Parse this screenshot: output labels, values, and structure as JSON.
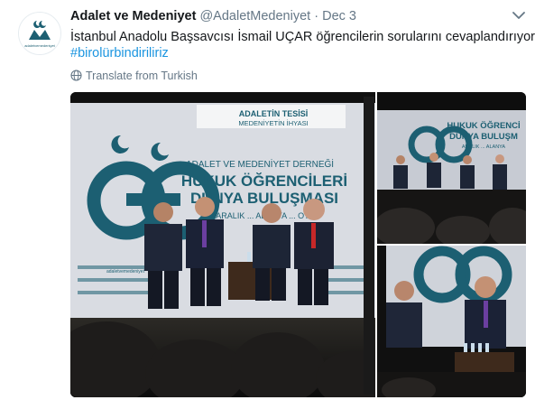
{
  "tweet": {
    "display_name": "Adalet ve Medeniyet",
    "handle": "@AdaletMedeniyet",
    "separator": "·",
    "date": "Dec 3",
    "text": "İstanbul Anadolu Başsavcısı İsmail UÇAR öğrencilerin sorularını cevaplandırıyor.",
    "hashtag": "#birolürbindiriliriz",
    "translate_label": "Translate from Turkish",
    "avatar_label": "adaletvemedeniyet"
  },
  "photo_main": {
    "header_line1": "ADALETİN TESİSİ",
    "header_line2": "MEDENİYETİN İHYASI",
    "title_line1": "ADALET VE MEDENİYET DERNEĞİ",
    "title_line2": "HUKUK ÖĞRENCİLERİ",
    "title_line3": "DÜNYA BULUŞMASI",
    "title_line4": "3 ARALIK ... ALANYA ... OTEL",
    "panel_label": "adaletvemedeniyet"
  },
  "photo_right_top": {
    "title_line1": "HUKUK ÖĞRENCİ",
    "title_line2": "DÜNYA BULUŞM",
    "title_line3": "ARALIK ... ALANYA"
  },
  "colors": {
    "brand_teal": "#1c5f72",
    "link_blue": "#1b95e0",
    "text_dark": "#14171a",
    "text_gray": "#657786"
  },
  "icons": [
    "chevron-down-icon",
    "globe-icon"
  ]
}
